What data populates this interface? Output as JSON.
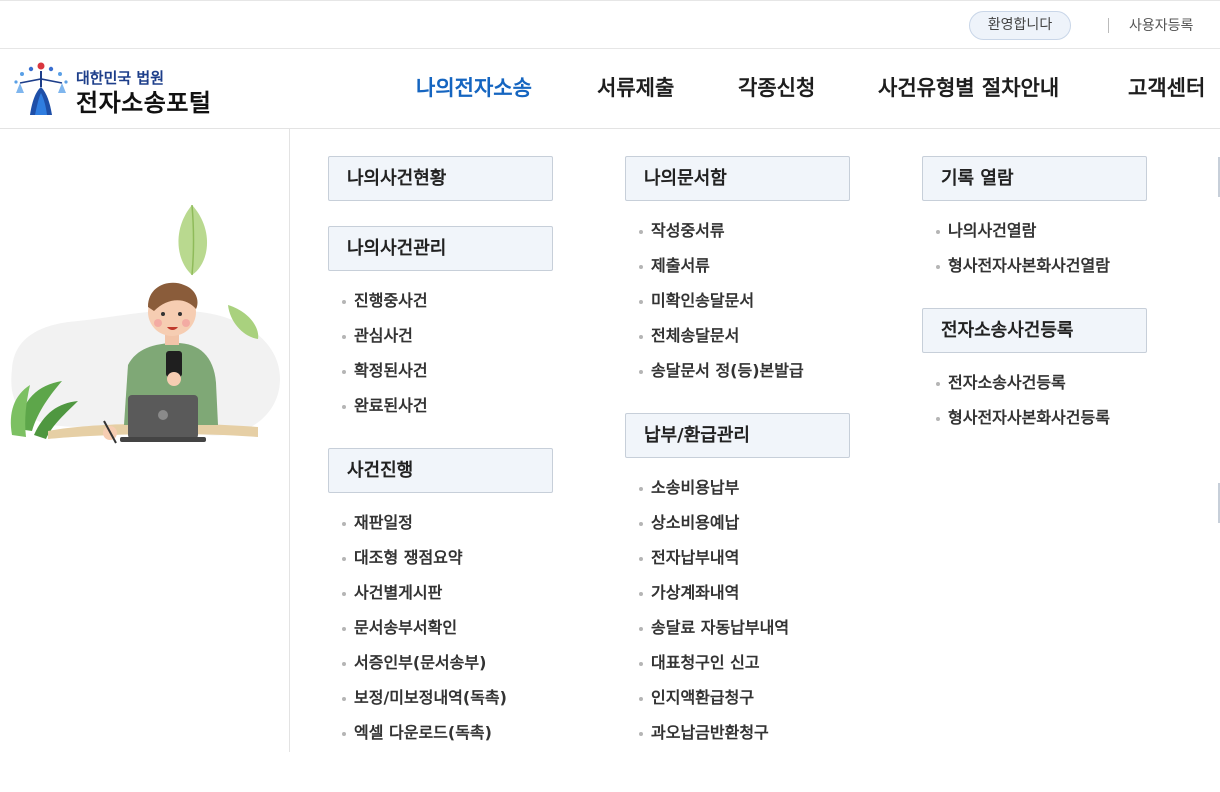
{
  "topbar": {
    "welcome": "환영합니다",
    "register": "사용자등록"
  },
  "logo": {
    "sub": "대한민국 법원",
    "main": "전자소송포털"
  },
  "gnb": [
    {
      "label": "나의전자소송",
      "active": true
    },
    {
      "label": "서류제출"
    },
    {
      "label": "각종신청"
    },
    {
      "label": "사건유형별 절차안내"
    },
    {
      "label": "고객센터"
    }
  ],
  "menu": {
    "col1": {
      "status_title": "나의사건현황",
      "manage_title": "나의사건관리",
      "manage_items": [
        "진행중사건",
        "관심사건",
        "확정된사건",
        "완료된사건"
      ],
      "progress_title": "사건진행",
      "progress_items": [
        "재판일정",
        "대조형 쟁점요약",
        "사건별게시판",
        "문서송부서확인",
        "서증인부(문서송부)",
        "보정/미보정내역(독촉)",
        "엑셀 다운로드(독촉)"
      ]
    },
    "col2": {
      "docs_title": "나의문서함",
      "docs_items": [
        "작성중서류",
        "제출서류",
        "미확인송달문서",
        "전체송달문서",
        "송달문서 정(등)본발급"
      ],
      "pay_title": "납부/환급관리",
      "pay_items": [
        "소송비용납부",
        "상소비용예납",
        "전자납부내역",
        "가상계좌내역",
        "송달료 자동납부내역",
        "대표청구인 신고",
        "인지액환급청구",
        "과오납금반환청구"
      ]
    },
    "col3": {
      "view_title": "기록 열람",
      "view_items": [
        "나의사건열람",
        "형사전자사본화사건열람"
      ],
      "reg_title": "전자소송사건등록",
      "reg_items": [
        "전자소송사건등록",
        "형사전자사본화사건등록"
      ]
    }
  },
  "colors": {
    "accent": "#1565c0",
    "brand": "#1d3e8a",
    "title_bg": "#f1f5fa",
    "title_border": "#c7cfd9"
  }
}
